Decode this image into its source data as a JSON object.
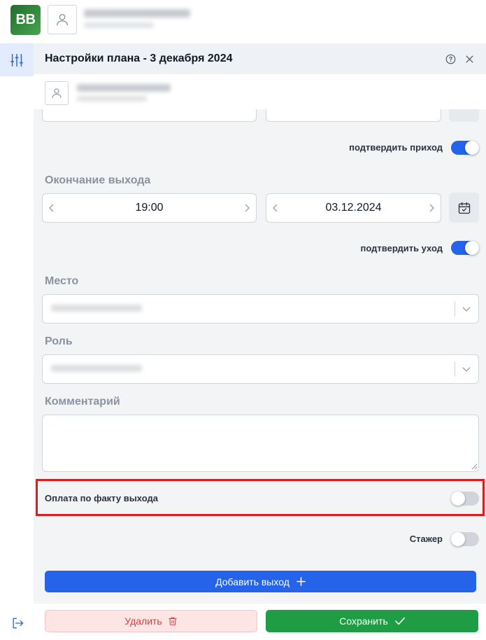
{
  "app": {
    "logo_text": "BB"
  },
  "panel": {
    "title": "Настройки плана - 3 декабря 2024",
    "help_icon": "help-circle-icon",
    "close_icon": "close-icon"
  },
  "confirm_arrival": {
    "label": "подтвердить приход",
    "enabled": true
  },
  "exit_end": {
    "label": "Окончание выхода",
    "time": "19:00",
    "date": "03.12.2024"
  },
  "confirm_departure": {
    "label": "подтвердить уход",
    "enabled": true
  },
  "place": {
    "label": "Место"
  },
  "role": {
    "label": "Роль"
  },
  "comment": {
    "label": "Комментарий",
    "value": ""
  },
  "pay_by_fact": {
    "label": "Оплата по факту выхода",
    "enabled": false
  },
  "trainee": {
    "label": "Стажер",
    "enabled": false
  },
  "actions": {
    "add_label": "Добавить выход",
    "delete_label": "Удалить",
    "save_label": "Сохранить"
  },
  "colors": {
    "primary": "#2563eb",
    "save": "#1f9d45",
    "delete_bg": "#fde5e5",
    "delete_text": "#dc3c3c",
    "highlight": "#e01b1b"
  }
}
